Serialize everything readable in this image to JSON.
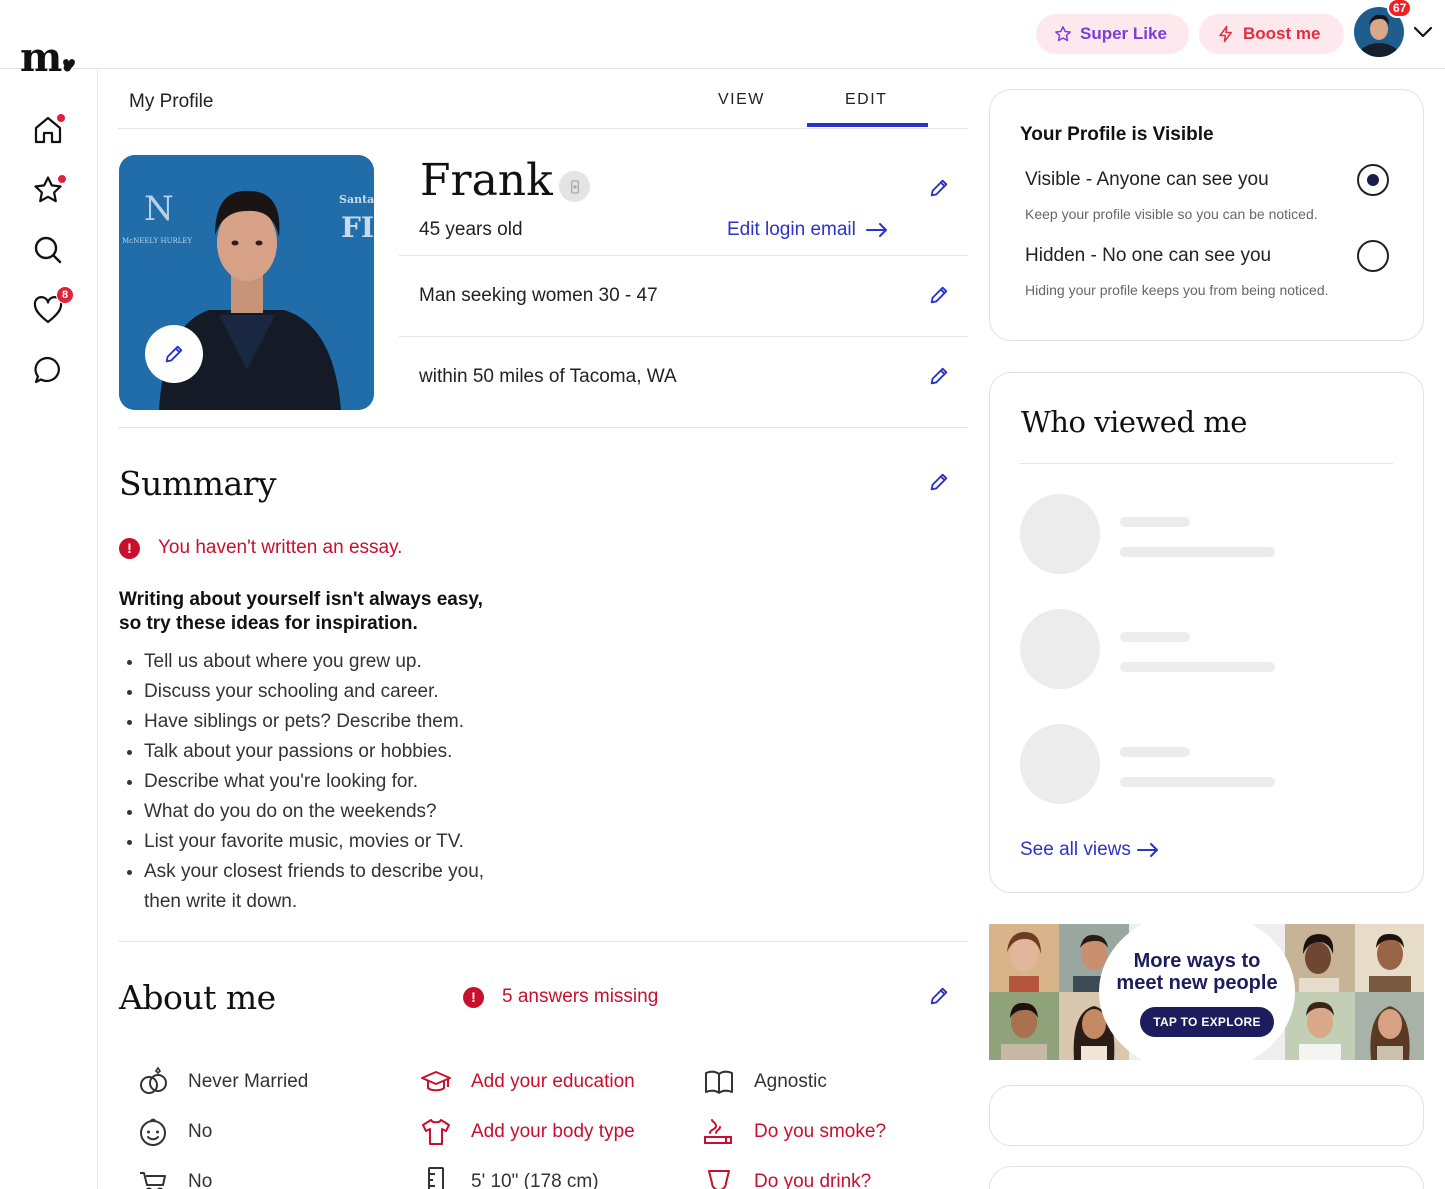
{
  "topbar": {
    "logo_text": "m.",
    "super_like_label": "Super Like",
    "boost_label": "Boost me",
    "avatar_badge": "67"
  },
  "rail": {
    "heart_badge": "8"
  },
  "profile": {
    "page_title": "My Profile",
    "tabs": [
      {
        "label": "VIEW"
      },
      {
        "label": "EDIT"
      }
    ],
    "active_tab": "EDIT",
    "name": "Frank",
    "age": "45 years old",
    "edit_login_email": "Edit login email",
    "seeking": "Man seeking women 30 - 47",
    "location": "within 50 miles of Tacoma, WA"
  },
  "summary": {
    "title": "Summary",
    "error": "You haven't written an essay.",
    "tip_head_1": "Writing about yourself isn't always easy,",
    "tip_head_2": "so try these ideas for inspiration.",
    "tips": [
      "Tell us about where you grew up.",
      "Discuss your schooling and career.",
      "Have siblings or pets? Describe them.",
      "Talk about your passions or hobbies.",
      "Describe what you're looking for.",
      "What do you do on the weekends?",
      "List your favorite music, movies or TV.",
      "Ask your closest friends to describe you, then write it down."
    ]
  },
  "about": {
    "title": "About me",
    "missing": "5 answers missing",
    "attributes": [
      {
        "icon": "rings-icon",
        "label": "Never Married",
        "missing": false
      },
      {
        "icon": "graduation-cap-icon",
        "label": "Add your education",
        "missing": true
      },
      {
        "icon": "book-icon",
        "label": "Agnostic",
        "missing": false
      },
      {
        "icon": "baby-face-icon",
        "label": "No",
        "missing": false
      },
      {
        "icon": "shirt-icon",
        "label": "Add your body type",
        "missing": true
      },
      {
        "icon": "smoke-icon",
        "label": "Do you smoke?",
        "missing": true
      },
      {
        "icon": "stroller-icon",
        "label": "No",
        "missing": false
      },
      {
        "icon": "ruler-icon",
        "label": "5' 10\" (178 cm)",
        "missing": false
      },
      {
        "icon": "drink-icon",
        "label": "Do you drink?",
        "missing": true
      }
    ]
  },
  "visibility": {
    "title": "Your Profile is Visible",
    "visible_label": "Visible - Anyone can see you",
    "visible_sub": "Keep your profile visible so you can be noticed.",
    "hidden_label": "Hidden - No one can see you",
    "hidden_sub": "Hiding your profile keeps you from being noticed.",
    "selected": "visible"
  },
  "who_viewed": {
    "title": "Who viewed me",
    "see_all": "See all views"
  },
  "promo": {
    "line1": "More ways to",
    "line2": "meet new people",
    "button": "TAP TO EXPLORE"
  },
  "colors": {
    "accent": "#2b33c9",
    "error": "#c8102e",
    "navy": "#1d1d5e",
    "pink_bg": "#fde8ee",
    "super_like": "#7a3fd6",
    "boost": "#e0303f"
  }
}
